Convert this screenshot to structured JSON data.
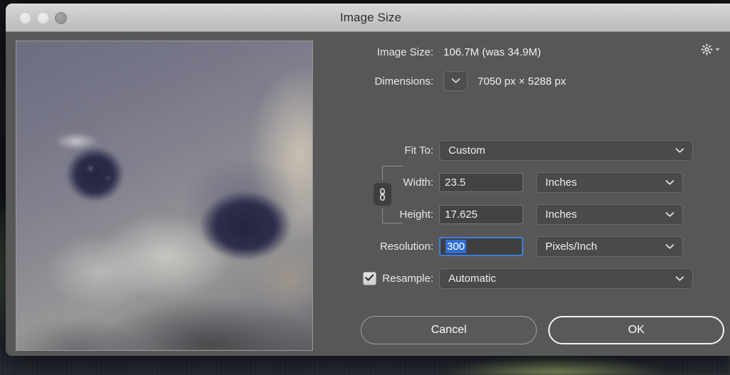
{
  "window": {
    "title": "Image Size",
    "traffic_lights": [
      "close",
      "minimize",
      "zoom"
    ]
  },
  "info": {
    "image_size_label": "Image Size:",
    "image_size_value": "106.7M (was 34.9M)",
    "gear_icon": "gear-icon",
    "dimensions_label": "Dimensions:",
    "dimensions_value": "7050 px  ×  5288 px",
    "dimensions_width": "7050 px",
    "dimensions_sep": "×",
    "dimensions_height": "5288 px"
  },
  "fields": {
    "fit_to_label": "Fit To:",
    "fit_to_value": "Custom",
    "width_label": "Width:",
    "width_value": "23.5",
    "width_unit": "Inches",
    "height_label": "Height:",
    "height_value": "17.625",
    "height_unit": "Inches",
    "resolution_label": "Resolution:",
    "resolution_value": "300",
    "resolution_unit": "Pixels/Inch",
    "resample_label": "Resample:",
    "resample_value": "Automatic",
    "resample_checked": true,
    "link_icon": "link-chain-icon"
  },
  "buttons": {
    "cancel": "Cancel",
    "ok": "OK"
  },
  "colors": {
    "dialog_bg": "#575757",
    "titlebar_top": "#d7d7d7",
    "titlebar_bottom": "#bcbcbc",
    "field_bg": "#434343",
    "select_bg": "#4a4a4a",
    "selection_blue": "#2f6fd4",
    "focus_ring": "#3d7fe0",
    "text": "#f0f0f0"
  },
  "preview": {
    "alt": "blurred close-up photograph of a marmot face"
  }
}
